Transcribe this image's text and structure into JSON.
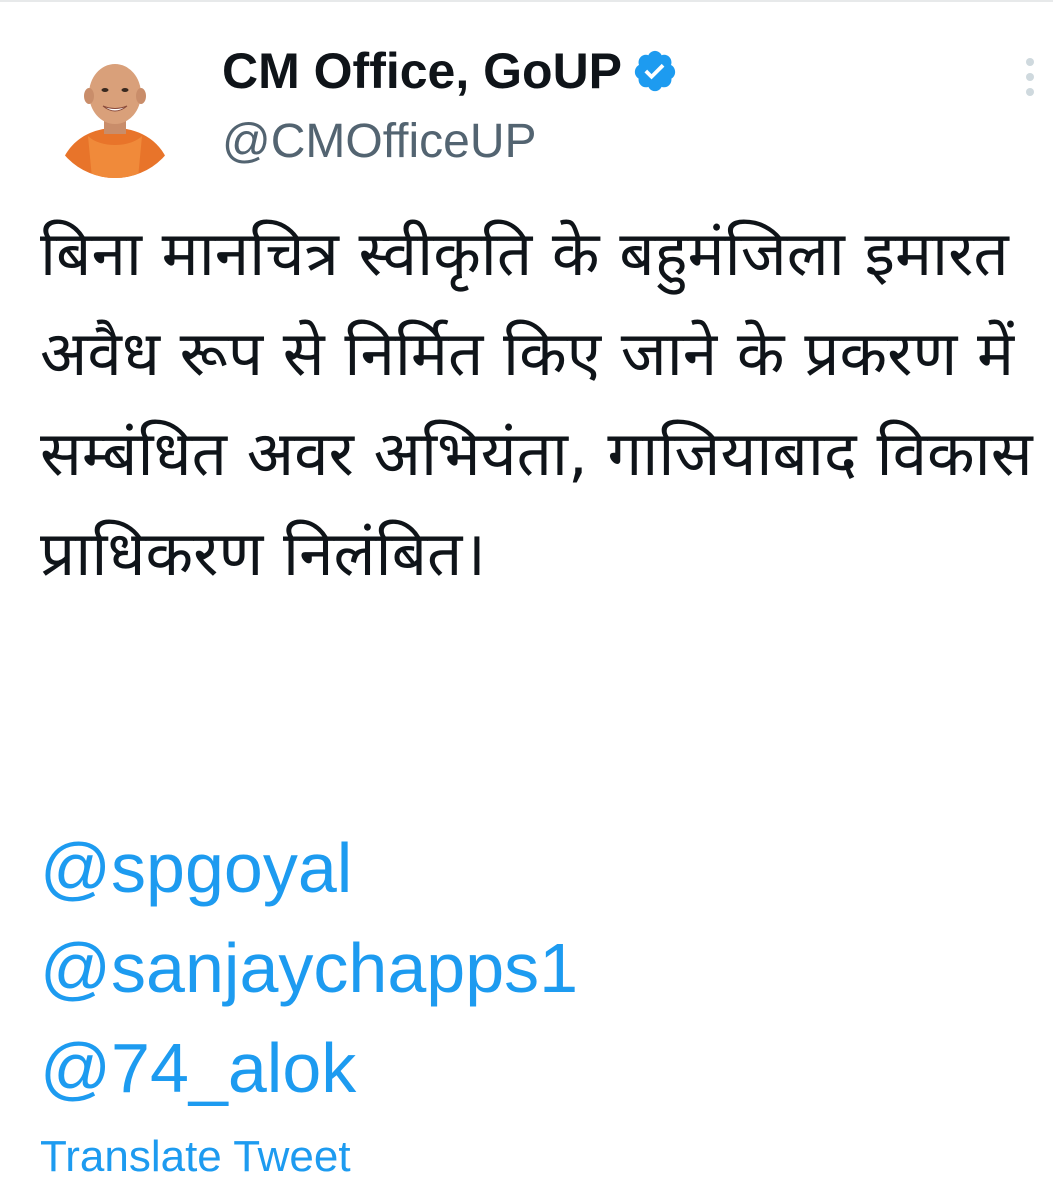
{
  "tweet": {
    "author": {
      "display_name": "CM Office, GoUP",
      "handle": "@CMOfficeUP",
      "verified": true
    },
    "text": "बिना मानचित्र स्वीकृति के बहुमंजिला इमारत अवैध रूप से निर्मित किए जाने के प्रकरण में सम्बंधित अवर अभियंता, गाजियाबाद विकास प्राधिकरण निलंबित।",
    "mentions": [
      "@spgoyal",
      "@sanjaychapps1",
      "@74_alok"
    ],
    "translate_label": "Translate Tweet"
  },
  "icons": {
    "verified": "verified-badge-icon",
    "more": "more-options-icon"
  },
  "colors": {
    "link": "#1d9bf0",
    "text": "#0f1419",
    "secondary": "#536471",
    "saffron": "#e8742a"
  }
}
